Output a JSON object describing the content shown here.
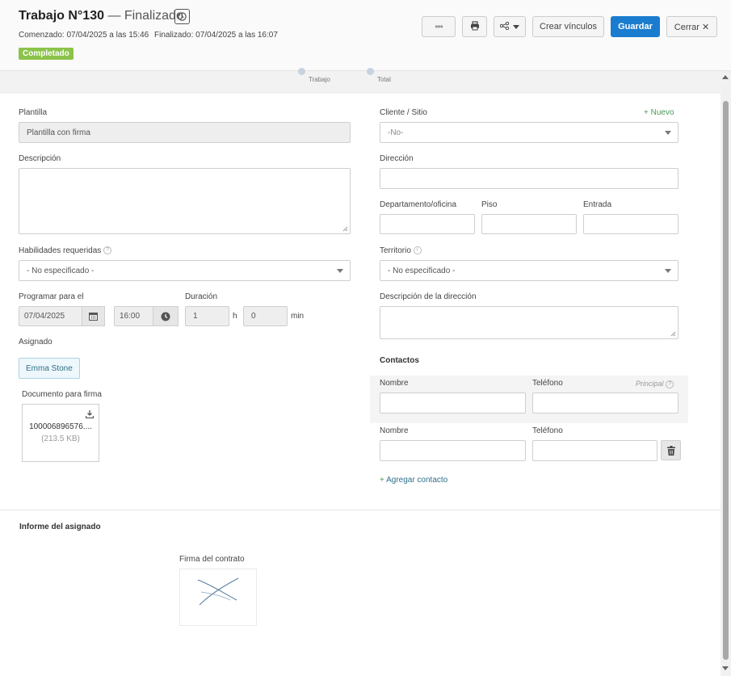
{
  "header": {
    "title": "Trabajo N°130",
    "separator": "—",
    "status_text": "Finalizado",
    "started": "Comenzado: 07/04/2025 a las 15:46",
    "finished": "Finalizado: 07/04/2025 a las 16:07",
    "badge": "Completado",
    "buttons": {
      "more": "•••",
      "create_links": "Crear vínculos",
      "save": "Guardar",
      "close": "Cerrar ✕"
    }
  },
  "strip": {
    "labels": [
      "Trabajo",
      "Total"
    ]
  },
  "left": {
    "template_label": "Plantilla",
    "template_value": "Plantilla con firma",
    "description_label": "Descripción",
    "skills_label": "Habilidades requeridas",
    "skills_value": "- No especificado -",
    "schedule_label": "Programar para el",
    "date_value": "07/04/2025",
    "time_value": "16:00",
    "duration_label": "Duración",
    "duration_hours": "1",
    "hours_unit": "h",
    "duration_minutes": "0",
    "minutes_unit": "min",
    "assigned_label": "Asignado",
    "assignee": "Emma Stone",
    "document_label": "Documento para firma",
    "document_name": "100006896576....",
    "document_size": "(213.5 KB)"
  },
  "right": {
    "client_label": "Cliente / Sitio",
    "new_link": "Nuevo",
    "client_value": "-No-",
    "address_label": "Dirección",
    "department_label": "Departamento/oficina",
    "floor_label": "Piso",
    "entrance_label": "Entrada",
    "territory_label": "Territorio",
    "territory_value": "- No especificado -",
    "address_desc_label": "Descripción de la dirección",
    "contacts_title": "Contactos",
    "contacts": [
      {
        "name_label": "Nombre",
        "phone_label": "Teléfono",
        "principal": "Principal"
      },
      {
        "name_label": "Nombre",
        "phone_label": "Teléfono"
      }
    ],
    "add_contact": "Agregar contacto"
  },
  "report": {
    "title": "Informe del asignado",
    "signature_label": "Firma del contrato"
  },
  "colors": {
    "primary": "#1a7ccf",
    "badge": "#8bc34a",
    "link_green": "#4a9a58"
  }
}
